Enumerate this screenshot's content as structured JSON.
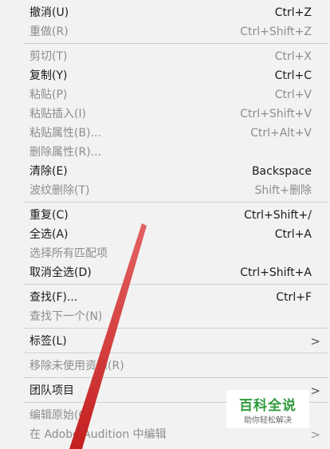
{
  "menu": {
    "items": [
      {
        "label": "撤消(U)",
        "shortcut": "Ctrl+Z",
        "enabled": true
      },
      {
        "label": "重做(R)",
        "shortcut": "Ctrl+Shift+Z",
        "enabled": false
      },
      {
        "label": "剪切(T)",
        "shortcut": "Ctrl+X",
        "enabled": false
      },
      {
        "label": "复制(Y)",
        "shortcut": "Ctrl+C",
        "enabled": true
      },
      {
        "label": "粘贴(P)",
        "shortcut": "Ctrl+V",
        "enabled": false
      },
      {
        "label": "粘贴插入(I)",
        "shortcut": "Ctrl+Shift+V",
        "enabled": false
      },
      {
        "label": "粘贴属性(B)...",
        "shortcut": "Ctrl+Alt+V",
        "enabled": false
      },
      {
        "label": "删除属性(R)...",
        "shortcut": "",
        "enabled": false
      },
      {
        "label": "清除(E)",
        "shortcut": "Backspace",
        "enabled": true
      },
      {
        "label": "波纹删除(T)",
        "shortcut": "Shift+删除",
        "enabled": false
      },
      {
        "label": "重复(C)",
        "shortcut": "Ctrl+Shift+/",
        "enabled": true
      },
      {
        "label": "全选(A)",
        "shortcut": "Ctrl+A",
        "enabled": true
      },
      {
        "label": "选择所有匹配项",
        "shortcut": "",
        "enabled": false
      },
      {
        "label": "取消全选(D)",
        "shortcut": "Ctrl+Shift+A",
        "enabled": true
      },
      {
        "label": "查找(F)...",
        "shortcut": "Ctrl+F",
        "enabled": true
      },
      {
        "label": "查找下一个(N)",
        "shortcut": "",
        "enabled": false
      },
      {
        "label": "标签(L)",
        "shortcut": "",
        "enabled": true,
        "submenu": ">"
      },
      {
        "label": "移除未使用资源(R)",
        "shortcut": "",
        "enabled": false
      },
      {
        "label": "团队项目",
        "shortcut": "",
        "enabled": true,
        "submenu": ">"
      },
      {
        "label": "编辑原始(O)",
        "shortcut": "",
        "enabled": false
      },
      {
        "label": "在 Adobe Audition 中编辑",
        "shortcut": "",
        "enabled": false,
        "submenu": ">"
      }
    ]
  },
  "watermark": {
    "title": "百科全说",
    "subtitle": "助你轻松解决",
    "color": "#2f9b3c"
  },
  "annotation": {
    "arrow_color": "#d42a2a"
  }
}
